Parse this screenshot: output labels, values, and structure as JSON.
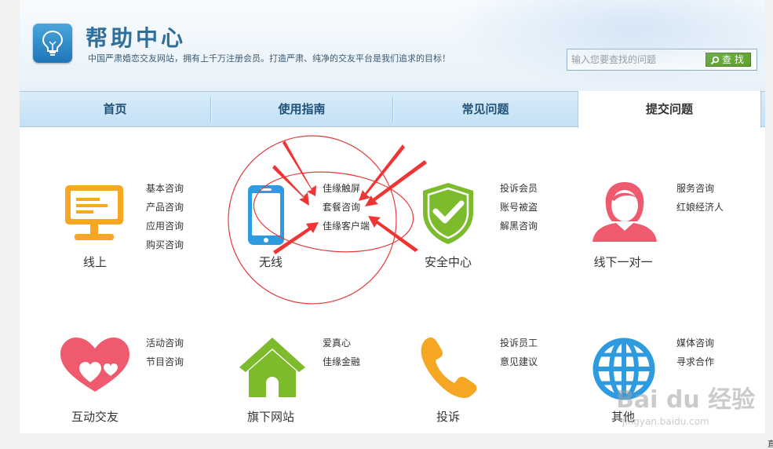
{
  "header": {
    "title": "帮助中心",
    "tagline": "中国严肃婚恋交友网站，拥有上千万注册会员。打造严肃、纯净的交友平台是我们追求的目标！",
    "search": {
      "placeholder": "输入您要查找的问题",
      "button_label": "查 找"
    }
  },
  "nav": {
    "tabs": [
      {
        "label": "首页"
      },
      {
        "label": "使用指南"
      },
      {
        "label": "常见问题"
      },
      {
        "label": "提交问题",
        "active": true
      }
    ]
  },
  "categories": [
    {
      "name": "线上",
      "icon": "monitor-icon",
      "color": "#f5a623",
      "items": [
        "基本咨询",
        "产品咨询",
        "应用咨询",
        "购买咨询"
      ]
    },
    {
      "name": "无线",
      "icon": "phone-icon",
      "color": "#2e9be0",
      "items": [
        "佳缘触屏",
        "套餐咨询",
        "佳缘客户端"
      ]
    },
    {
      "name": "安全中心",
      "icon": "shield-icon",
      "color": "#7cbb2c",
      "items": [
        "投诉会员",
        "账号被盗",
        "解黑咨询"
      ]
    },
    {
      "name": "线下一对一",
      "icon": "person-icon",
      "color": "#ef5a6e",
      "items": [
        "服务咨询",
        "红娘经济人"
      ]
    },
    {
      "name": "互动交友",
      "icon": "hearts-icon",
      "color": "#ef5a6e",
      "items": [
        "活动咨询",
        "节目咨询"
      ]
    },
    {
      "name": "旗下网站",
      "icon": "house-icon",
      "color": "#7cbb2c",
      "items": [
        "爱真心",
        "佳缘金融"
      ]
    },
    {
      "name": "投诉",
      "icon": "telephone-icon",
      "color": "#f5a623",
      "items": [
        "投诉员工",
        "意见建议"
      ]
    },
    {
      "name": "其他",
      "icon": "globe-icon",
      "color": "#2e9be0",
      "items": [
        "媒体咨询",
        "寻求合作"
      ]
    }
  ],
  "watermark": {
    "main": "Bai du 经验",
    "sub": "jingyan.baidu.com"
  },
  "edge_char": "直"
}
